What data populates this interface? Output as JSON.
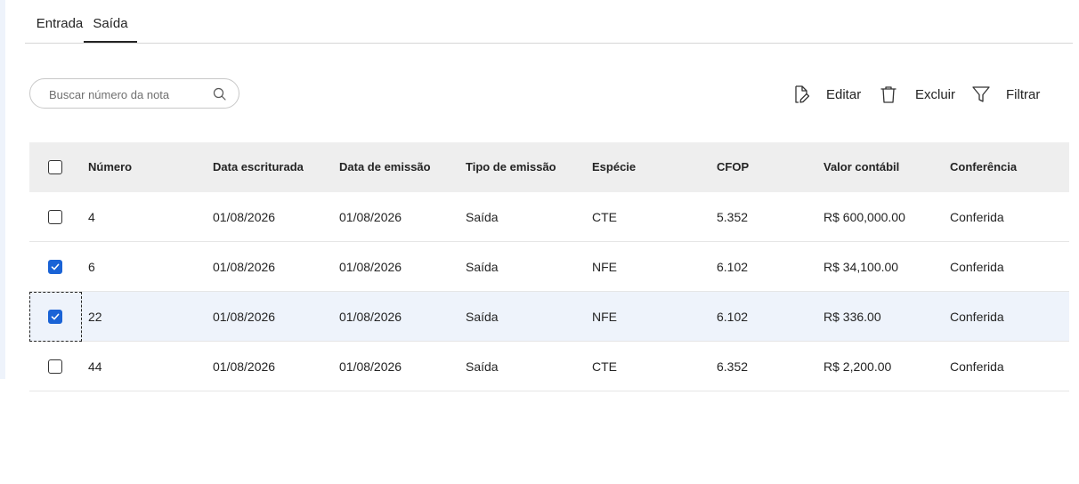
{
  "tabs": [
    {
      "label": "Entrada",
      "active": false
    },
    {
      "label": "Saída",
      "active": true
    }
  ],
  "search": {
    "placeholder": "Buscar número da nota",
    "value": "",
    "icon": "search-icon"
  },
  "actions": {
    "edit_label": "Editar",
    "delete_label": "Excluir",
    "filter_label": "Filtrar"
  },
  "table": {
    "columns": [
      "Número",
      "Data escriturada",
      "Data de emissão",
      "Tipo de emissão",
      "Espécie",
      "CFOP",
      "Valor contábil",
      "Conferência"
    ],
    "select_all_checked": false,
    "rows": [
      {
        "checked": false,
        "cells": [
          "4",
          "01/08/2026",
          "01/08/2026",
          "Saída",
          "CTE",
          "5.352",
          "R$ 600,000.00",
          "Conferida"
        ]
      },
      {
        "checked": true,
        "cells": [
          "6",
          "01/08/2026",
          "01/08/2026",
          "Saída",
          "NFE",
          "6.102",
          "R$ 34,100.00",
          "Conferida"
        ]
      },
      {
        "checked": true,
        "cells": [
          "22",
          "01/08/2026",
          "01/08/2026",
          "Saída",
          "NFE",
          "6.102",
          "R$ 336.00",
          "Conferida"
        ]
      },
      {
        "checked": false,
        "cells": [
          "44",
          "01/08/2026",
          "01/08/2026",
          "Saída",
          "CTE",
          "6.352",
          "R$ 2,200.00",
          "Conferida"
        ]
      }
    ]
  },
  "colors": {
    "accent": "#1a63d6",
    "header_bg": "#eeeeee",
    "selected_row_bg": "#eef3fb"
  }
}
